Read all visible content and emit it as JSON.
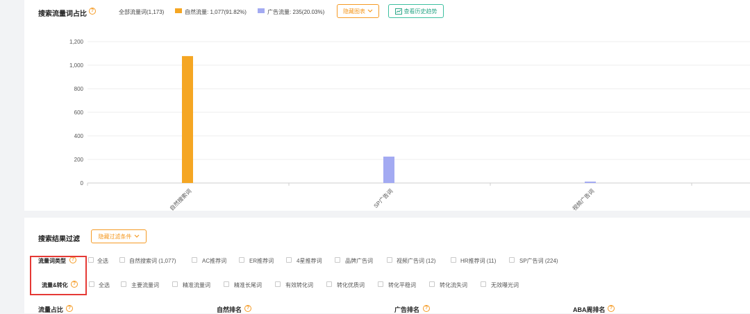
{
  "chart_section": {
    "title": "搜索流量词占比",
    "legend": {
      "total": "全部流量词(1,173)",
      "natural": "自然流量: 1,077(91.82%)",
      "ad": "广告流量: 235(20.03%)"
    },
    "hide_chart_label": "隐藏图表",
    "history_trend_label": "查看历史趋势"
  },
  "colors": {
    "natural": "#f5a623",
    "ad": "#a3aaf2",
    "accent": "#f59a23",
    "green": "#3cbf9f",
    "highlight": "#e53935"
  },
  "chart_data": {
    "type": "bar",
    "categories": [
      "自然搜索词",
      "SP广告词",
      "视频广告词"
    ],
    "values": [
      1077,
      224,
      12
    ],
    "colors": [
      "#f5a623",
      "#a3aaf2",
      "#a3aaf2"
    ],
    "title": "",
    "xlabel": "",
    "ylabel": "",
    "ylim": [
      0,
      1200
    ],
    "yticks": [
      "0",
      "200",
      "400",
      "600",
      "800",
      "1,000",
      "1,200"
    ],
    "grid": true
  },
  "filter_section": {
    "title": "搜索结果过滤",
    "hide_filter_label": "隐藏过滤条件",
    "rows": [
      {
        "label": "流量词类型",
        "options": [
          "全选",
          "自然搜索词 (1,077)",
          "AC推荐词",
          "ER推荐词",
          "4星推荐词",
          "品牌广告词",
          "视频广告词 (12)",
          "HR推荐词 (11)",
          "SP广告词 (224)"
        ]
      },
      {
        "label": "流量&转化",
        "options": [
          "全选",
          "主要流量词",
          "精准流量词",
          "精准长尾词",
          "有效转化词",
          "转化优质词",
          "转化平稳词",
          "转化流失词",
          "无效曝光词"
        ]
      }
    ],
    "columns": [
      "流量占比",
      "自然排名",
      "广告排名",
      "ABA周排名"
    ]
  }
}
